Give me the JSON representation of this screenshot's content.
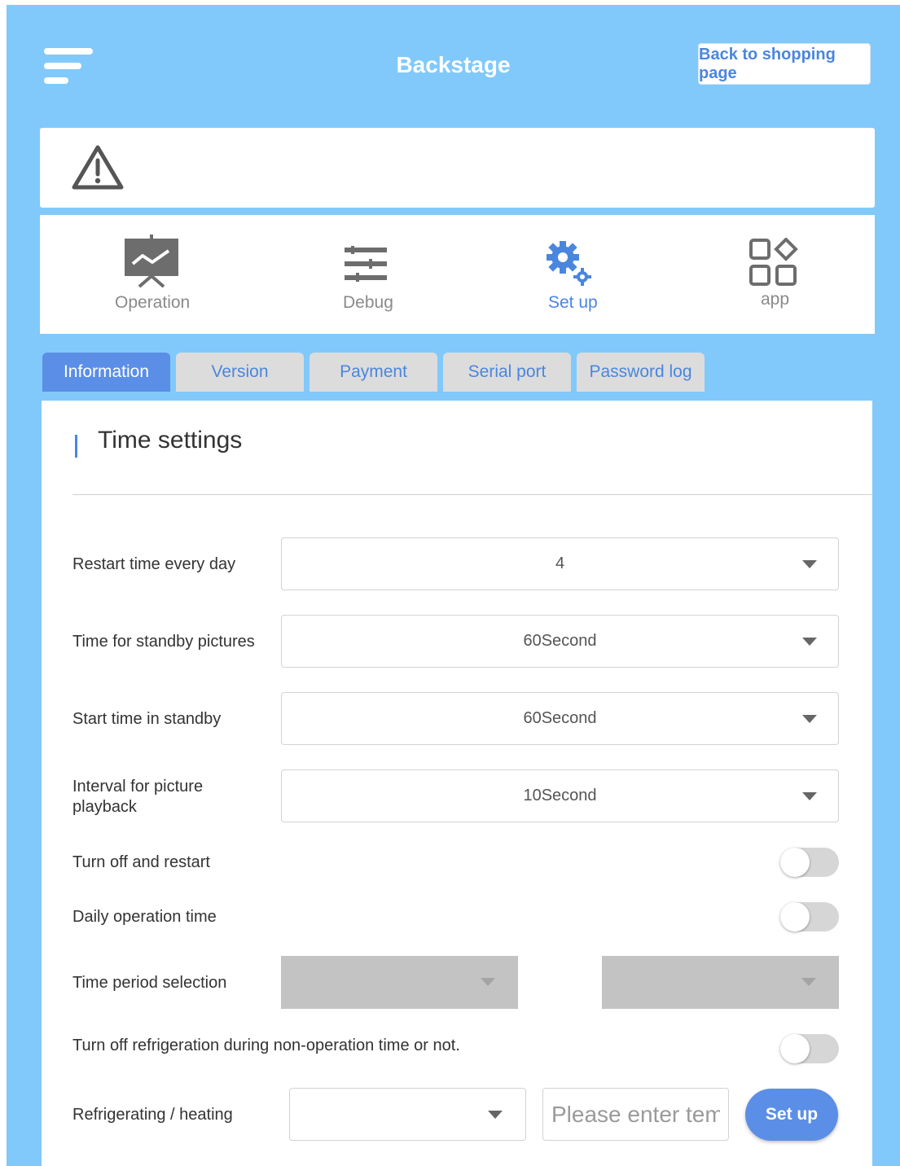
{
  "header": {
    "title": "Backstage",
    "back_button": "Back to shopping page"
  },
  "main_nav": [
    {
      "label": "Operation",
      "icon": "presentation-chart-icon"
    },
    {
      "label": "Debug",
      "icon": "sliders-icon"
    },
    {
      "label": "Set up",
      "icon": "gears-icon",
      "active": true
    },
    {
      "label": "app",
      "icon": "apps-grid-icon"
    }
  ],
  "tabs": [
    {
      "label": "Information",
      "active": true
    },
    {
      "label": "Version"
    },
    {
      "label": "Payment"
    },
    {
      "label": "Serial port"
    },
    {
      "label": "Password log"
    }
  ],
  "section": {
    "title": "Time settings"
  },
  "settings": {
    "restart_time": {
      "label": "Restart time every day",
      "value": "4"
    },
    "standby_pictures": {
      "label": "Time for standby pictures",
      "value": "60Second"
    },
    "standby_start": {
      "label": "Start time in standby",
      "value": "60Second"
    },
    "picture_interval": {
      "label": "Interval for picture playback",
      "value": "10Second"
    },
    "turn_off_restart": {
      "label": "Turn off and restart",
      "enabled": false
    },
    "daily_operation": {
      "label": "Daily operation time",
      "enabled": false
    },
    "time_period": {
      "label": "Time period selection",
      "start": "",
      "end": ""
    },
    "refrigeration_off": {
      "label": "Turn off refrigeration during non-operation time or not.",
      "enabled": false
    },
    "refrigerating": {
      "label": "Refrigerating / heating",
      "mode": "",
      "placeholder": "Please enter temperature",
      "button": "Set up"
    }
  },
  "colors": {
    "background": "#81c9fb",
    "accent": "#4a86de",
    "active_tab": "#5b8ee7",
    "toggle_off": "#d6d6d6"
  }
}
